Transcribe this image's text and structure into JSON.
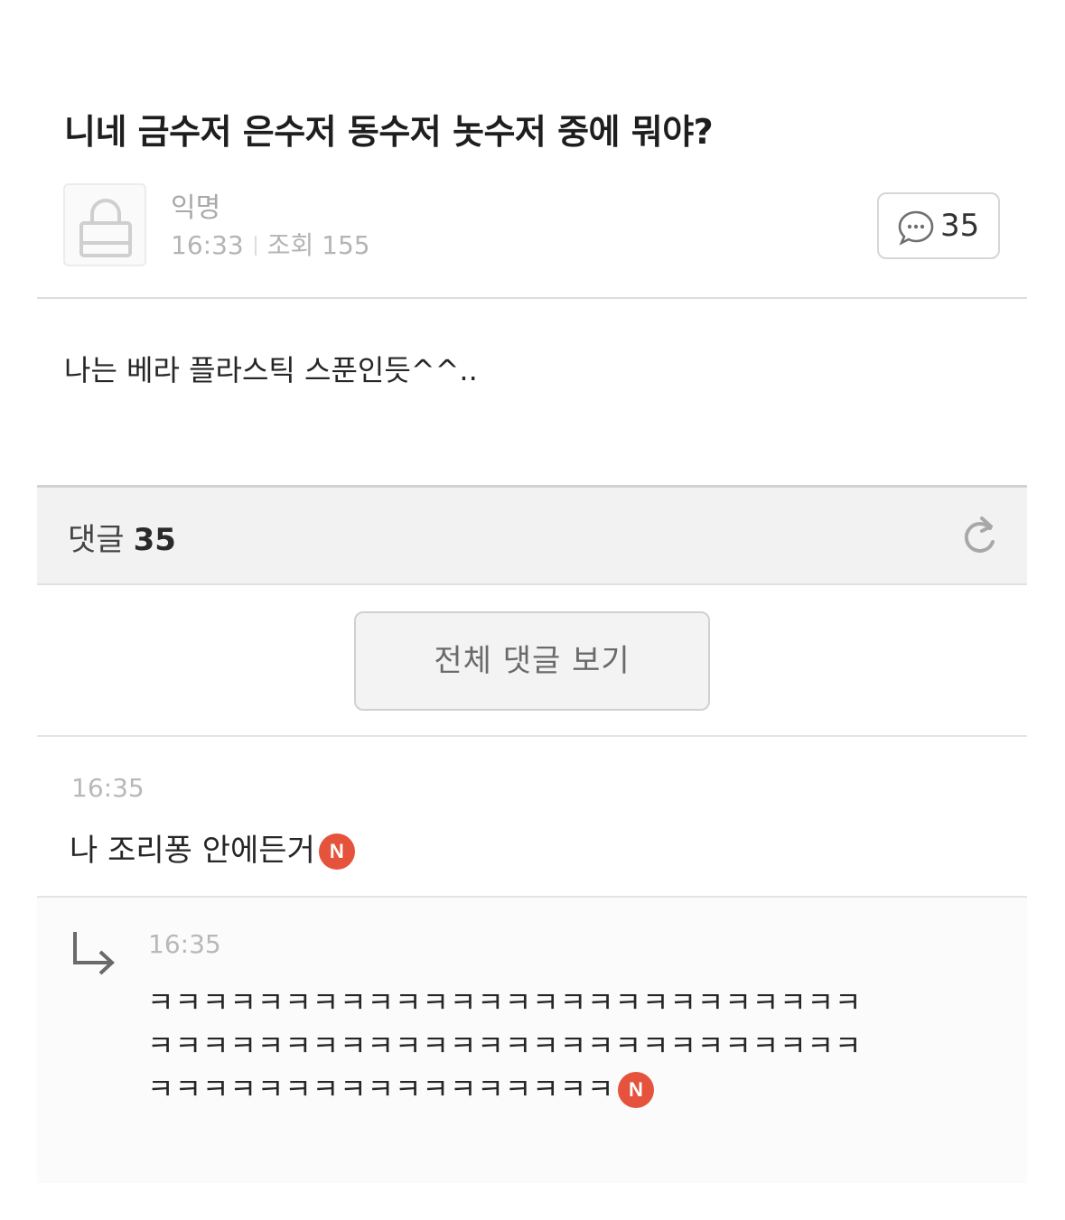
{
  "post": {
    "title": "니네 금수저 은수저 동수저 놋수저 중에 뭐야?",
    "author": "익명",
    "time": "16:33",
    "views_label": "조회 155",
    "comment_count": "35",
    "body": "나는 베라 플라스틱 스푼인듯^^.."
  },
  "comments_section": {
    "label": "댓글",
    "count": "35",
    "view_all_label": "전체 댓글 보기"
  },
  "comments": [
    {
      "time": "16:35",
      "text": "나 조리퐁 안에든거",
      "badge": "N"
    }
  ],
  "replies": [
    {
      "time": "16:35",
      "text": "ㅋㅋㅋㅋㅋㅋㅋㅋㅋㅋㅋㅋㅋㅋㅋㅋㅋㅋㅋㅋㅋㅋㅋㅋㅋㅋㅋㅋㅋㅋㅋㅋㅋㅋㅋㅋㅋㅋㅋㅋㅋㅋㅋㅋㅋㅋㅋㅋㅋㅋㅋㅋㅋㅋㅋㅋㅋㅋㅋㅋㅋㅋㅋㅋㅋㅋㅋㅋㅋ",
      "badge": "N"
    }
  ],
  "icons": {
    "avatar": "lock-icon",
    "comment_count": "speech-bubble-icon",
    "refresh": "refresh-icon",
    "reply": "reply-arrow-icon"
  },
  "colors": {
    "new_badge": "#e5533c",
    "bar_background": "#f2f2f2"
  }
}
